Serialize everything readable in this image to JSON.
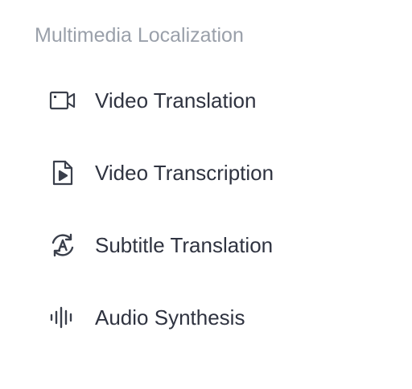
{
  "section": {
    "title": "Multimedia Localization"
  },
  "menu": {
    "items": [
      {
        "label": "Video Translation",
        "icon": "video-camera-icon"
      },
      {
        "label": "Video Transcription",
        "icon": "play-document-icon"
      },
      {
        "label": "Subtitle Translation",
        "icon": "letter-a-refresh-icon"
      },
      {
        "label": "Audio Synthesis",
        "icon": "audio-waveform-icon"
      }
    ]
  },
  "colors": {
    "title": "#9aa0aa",
    "text": "#2f3340",
    "icon": "#3a3f4b"
  }
}
